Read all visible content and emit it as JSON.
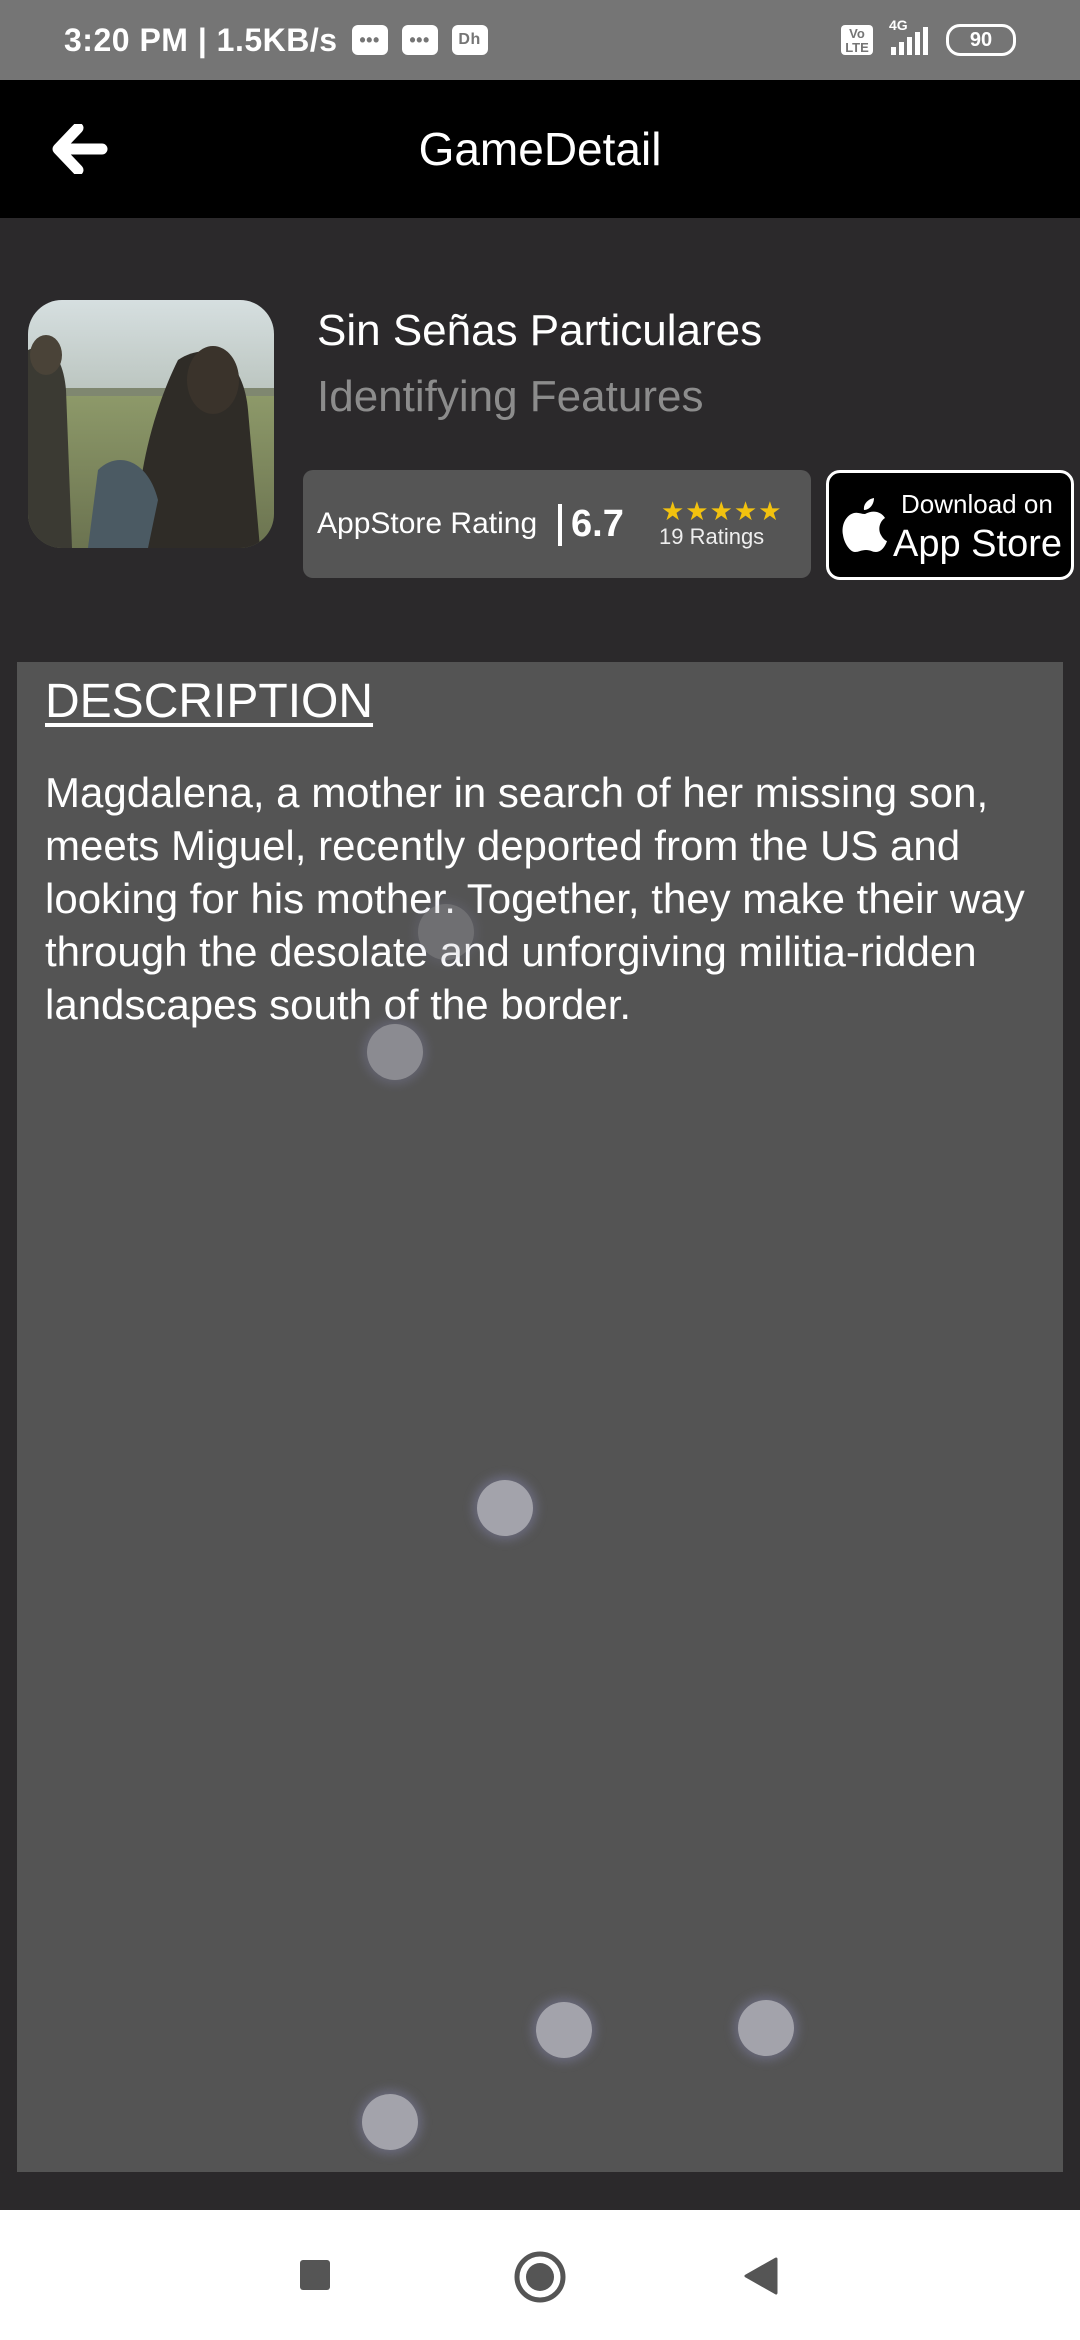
{
  "status_bar": {
    "time_speed": "3:20 PM | 1.5KB/s",
    "icons": [
      "message-icon",
      "message-icon",
      "hotstar-icon"
    ],
    "volte": "Vo\nLTE",
    "network": "4G",
    "battery": "90"
  },
  "app_bar": {
    "title": "GameDetail",
    "back_icon": "arrow-left-icon"
  },
  "game": {
    "title": "Sin Señas Particulares",
    "subtitle": "Identifying Features",
    "rating_label": "AppStore Rating",
    "rating_value": "6.7",
    "stars": "★★★★★",
    "rating_count": "19 Ratings"
  },
  "appstore_button": {
    "small_text": "Download on",
    "big_text": "App Store",
    "icon": "apple-icon"
  },
  "description": {
    "heading": "DESCRIPTION",
    "body": "Magdalena, a mother in search of her missing son, meets Miguel, recently deported from the US and looking for his mother. Together, they make their way through the desolate and unforgiving militia-ridden landscapes south of the border."
  },
  "nav_bar": {
    "buttons": [
      "recents-square-icon",
      "home-circle-icon",
      "back-triangle-icon"
    ]
  },
  "colors": {
    "background": "#2b292b",
    "app_bar": "#000000",
    "panel": "#545454",
    "star": "#f2c20f",
    "subtitle": "#8c8c8c"
  }
}
